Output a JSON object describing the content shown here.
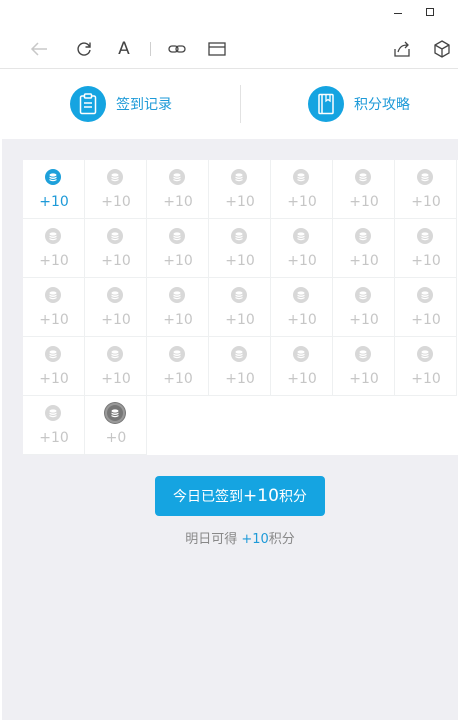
{
  "window": {
    "minimize_icon": "minimize-icon",
    "maximize_icon": "maximize-icon"
  },
  "toolbar": {
    "back_icon": "back-arrow-icon",
    "refresh_icon": "refresh-icon",
    "font_label": "A",
    "link_icon": "link-icon",
    "reader_icon": "reader-view-icon",
    "share_icon": "share-icon",
    "package_icon": "package-icon"
  },
  "nav": {
    "left_label": "签到记录",
    "right_label": "积分攻略",
    "left_icon": "clipboard-icon",
    "right_icon": "book-icon"
  },
  "days": [
    {
      "label": "+10",
      "state": "active"
    },
    {
      "label": "+10",
      "state": "inactive"
    },
    {
      "label": "+10",
      "state": "inactive"
    },
    {
      "label": "+10",
      "state": "inactive"
    },
    {
      "label": "+10",
      "state": "inactive"
    },
    {
      "label": "+10",
      "state": "inactive"
    },
    {
      "label": "+10",
      "state": "inactive"
    },
    {
      "label": "+10",
      "state": "inactive"
    },
    {
      "label": "+10",
      "state": "inactive"
    },
    {
      "label": "+10",
      "state": "inactive"
    },
    {
      "label": "+10",
      "state": "inactive"
    },
    {
      "label": "+10",
      "state": "inactive"
    },
    {
      "label": "+10",
      "state": "inactive"
    },
    {
      "label": "+10",
      "state": "inactive"
    },
    {
      "label": "+10",
      "state": "inactive"
    },
    {
      "label": "+10",
      "state": "inactive"
    },
    {
      "label": "+10",
      "state": "inactive"
    },
    {
      "label": "+10",
      "state": "inactive"
    },
    {
      "label": "+10",
      "state": "inactive"
    },
    {
      "label": "+10",
      "state": "inactive"
    },
    {
      "label": "+10",
      "state": "inactive"
    },
    {
      "label": "+10",
      "state": "inactive"
    },
    {
      "label": "+10",
      "state": "inactive"
    },
    {
      "label": "+10",
      "state": "inactive"
    },
    {
      "label": "+10",
      "state": "inactive"
    },
    {
      "label": "+10",
      "state": "inactive"
    },
    {
      "label": "+10",
      "state": "inactive"
    },
    {
      "label": "+10",
      "state": "inactive"
    },
    {
      "label": "+10",
      "state": "inactive"
    },
    {
      "label": "+0",
      "state": "today"
    }
  ],
  "checkin": {
    "prefix": "今日已签到",
    "points": "+10",
    "suffix": "积分"
  },
  "tomorrow": {
    "prefix": "明日可得",
    "points": "+10",
    "suffix": "积分"
  },
  "colors": {
    "accent": "#15a4e1",
    "accent_text": "#1e9ad8",
    "inactive_coin": "#d8d8d8",
    "inactive_text": "#c6c6c6",
    "background": "#efeff3"
  }
}
